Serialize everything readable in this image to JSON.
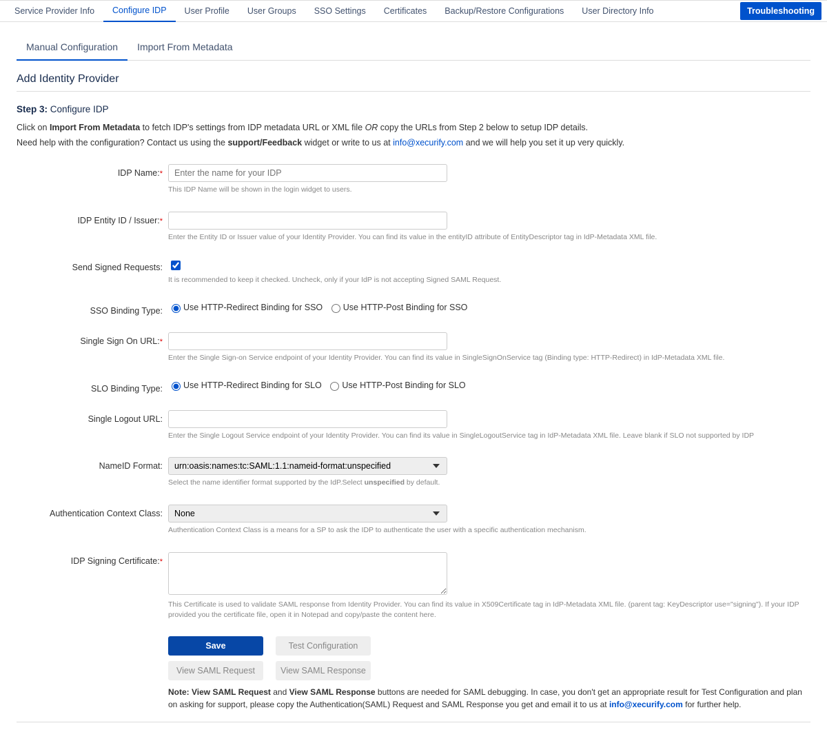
{
  "topTabs": {
    "items": [
      {
        "label": "Service Provider Info"
      },
      {
        "label": "Configure IDP",
        "active": true
      },
      {
        "label": "User Profile"
      },
      {
        "label": "User Groups"
      },
      {
        "label": "SSO Settings"
      },
      {
        "label": "Certificates"
      },
      {
        "label": "Backup/Restore Configurations"
      },
      {
        "label": "User Directory Info"
      }
    ],
    "troubleshoot": "Troubleshooting"
  },
  "subTabs": {
    "items": [
      {
        "label": "Manual Configuration",
        "active": true
      },
      {
        "label": "Import From Metadata"
      }
    ]
  },
  "pageTitle": "Add Identity Provider",
  "step": {
    "prefix": "Step 3:",
    "title": "Configure IDP"
  },
  "desc1": {
    "pre": "Click on ",
    "bold": "Import From Metadata",
    "mid": " to fetch IDP's settings from IDP metadata URL or XML file ",
    "or": "OR",
    "post": " copy the URLs from Step 2 below to setup IDP details."
  },
  "desc2": {
    "pre": "Need help with the configuration? Contact us using the ",
    "bold": "support/Feedback",
    "mid": " widget or write to us at ",
    "email": "info@xecurify.com",
    "post": " and we will help you set it up very quickly."
  },
  "form": {
    "idpName": {
      "label": "IDP Name:",
      "placeholder": "Enter the name for your IDP",
      "help": "This IDP Name will be shown in the login widget to users."
    },
    "entityId": {
      "label": "IDP Entity ID / Issuer:",
      "help": "Enter the Entity ID or Issuer value of your Identity Provider. You can find its value in the entityID attribute of EntityDescriptor tag in IdP-Metadata XML file."
    },
    "signed": {
      "label": "Send Signed Requests:",
      "help": "It is recommended to keep it checked. Uncheck, only if your IdP is not accepting Signed SAML Request."
    },
    "ssoBinding": {
      "label": "SSO Binding Type:",
      "opt1": "Use HTTP-Redirect Binding for SSO",
      "opt2": "Use HTTP-Post Binding for SSO"
    },
    "ssoUrl": {
      "label": "Single Sign On URL:",
      "help": "Enter the Single Sign-on Service endpoint of your Identity Provider. You can find its value in SingleSignOnService tag (Binding type: HTTP-Redirect) in IdP-Metadata XML file."
    },
    "sloBinding": {
      "label": "SLO Binding Type:",
      "opt1": "Use HTTP-Redirect Binding for SLO",
      "opt2": "Use HTTP-Post Binding for SLO"
    },
    "sloUrl": {
      "label": "Single Logout URL:",
      "help": "Enter the Single Logout Service endpoint of your Identity Provider. You can find its value in SingleLogoutService tag in IdP-Metadata XML file. Leave blank if SLO not supported by IDP"
    },
    "nameId": {
      "label": "NameID Format:",
      "value": "urn:oasis:names:tc:SAML:1.1:nameid-format:unspecified",
      "helpPre": "Select the name identifier format supported by the IdP.Select ",
      "helpBold": "unspecified",
      "helpPost": " by default."
    },
    "authCtx": {
      "label": "Authentication Context Class:",
      "value": "None",
      "help": "Authentication Context Class is a means for a SP to ask the IDP to authenticate the user with a specific authentication mechanism."
    },
    "cert": {
      "label": "IDP Signing Certificate:",
      "help": "This Certificate is used to validate SAML response from Identity Provider. You can find its value in X509Certificate tag in IdP-Metadata XML file. (parent tag: KeyDescriptor use=\"signing\"). If your IDP provided you the certificate file, open it in Notepad and copy/paste the content here."
    }
  },
  "buttons": {
    "save": "Save",
    "test": "Test Configuration",
    "viewReq": "View SAML Request",
    "viewResp": "View SAML Response"
  },
  "note": {
    "pre": "Note: View SAML Request",
    "and": " and ",
    "bold2": "View SAML Response",
    "mid": " buttons are needed for SAML debugging. In case, you don't get an appropriate result for Test Configuration and plan on asking for support, please copy the Authentication(SAML) Request and SAML Response you get and email it to us at ",
    "email": "info@xecurify.com",
    "post": " for further help."
  }
}
